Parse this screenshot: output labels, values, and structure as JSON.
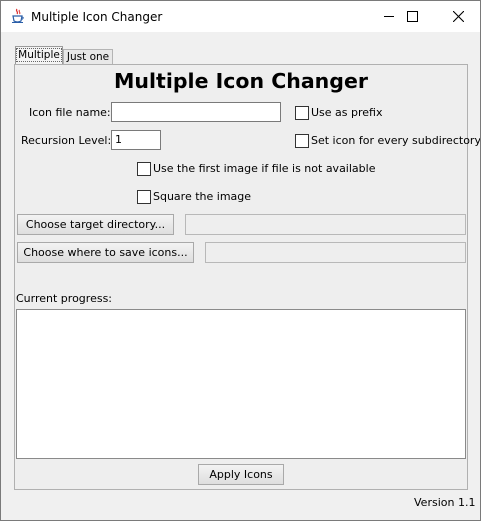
{
  "window": {
    "title": "Multiple Icon Changer",
    "app_icon": "java-cup-icon",
    "controls": [
      "minimize-icon",
      "maximize-icon",
      "close-icon"
    ]
  },
  "tabs": [
    {
      "label": "Multiple",
      "selected": true
    },
    {
      "label": "Just one",
      "selected": false
    }
  ],
  "main": {
    "heading": "Multiple Icon Changer",
    "icon_file_name_label": "Icon file name:",
    "icon_file_name_value": "",
    "use_as_prefix_label": "Use as prefix",
    "use_as_prefix_checked": false,
    "recursion_level_label": "Recursion Level:",
    "recursion_level_value": "1",
    "set_icon_every_subdir_label": "Set icon for every subdirectory",
    "set_icon_every_subdir_checked": false,
    "use_first_image_label": "Use the first image if file is not available",
    "use_first_image_checked": false,
    "square_image_label": "Square the image",
    "square_image_checked": false,
    "choose_target_dir_label": "Choose target directory...",
    "target_dir_value": "",
    "choose_save_icons_label": "Choose where to save icons...",
    "save_icons_value": "",
    "current_progress_label": "Current progress:",
    "progress_text": "",
    "apply_icons_label": "Apply Icons"
  },
  "footer": {
    "version": "Version 1.1"
  },
  "colors": {
    "window_bg": "#f0f0f0",
    "titlebar_bg": "#ffffff",
    "panel_bg": "#eeeeee"
  }
}
